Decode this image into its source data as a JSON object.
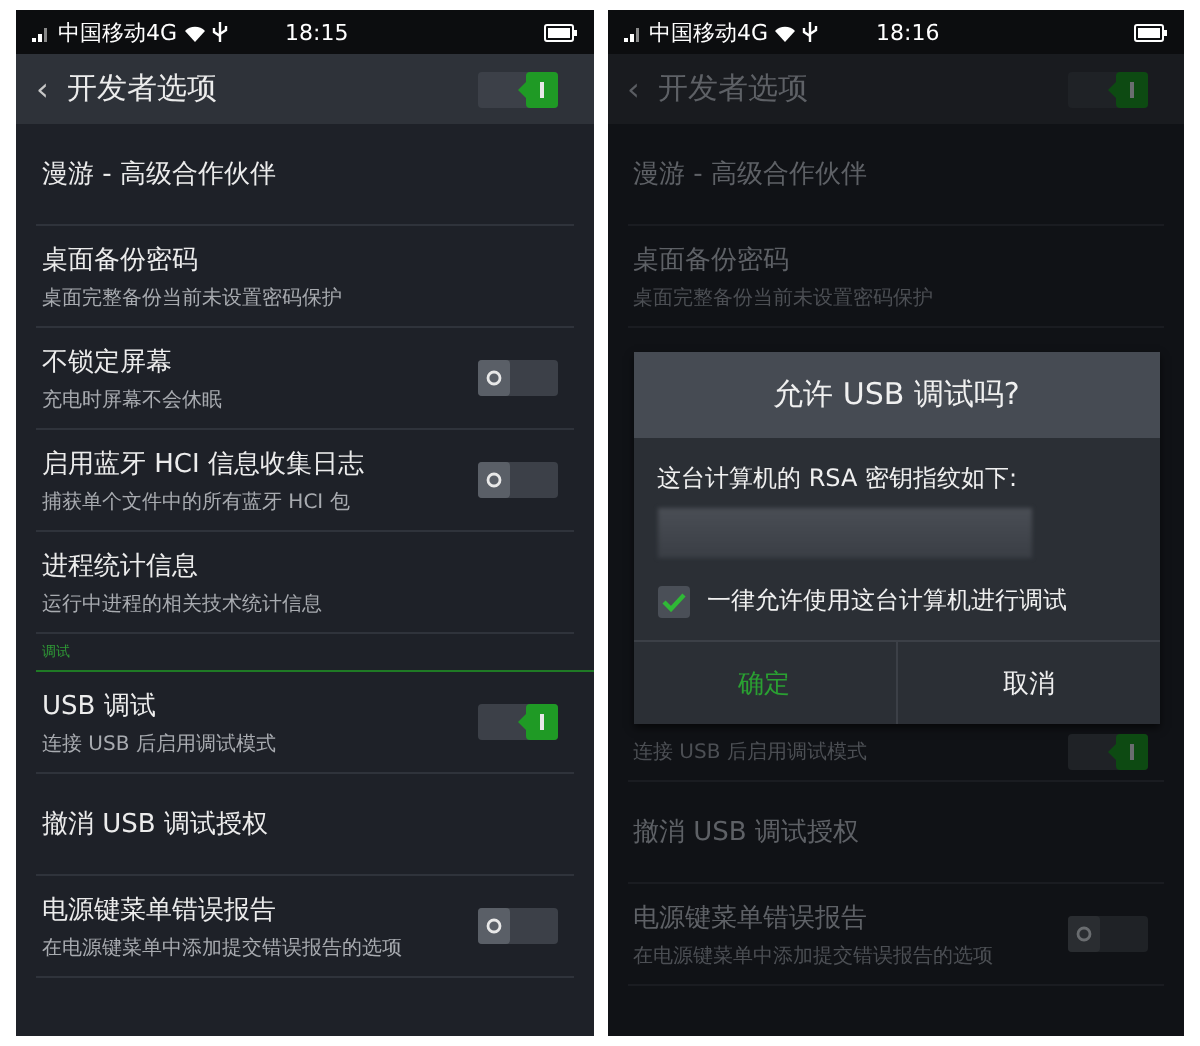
{
  "screens": [
    {
      "dimmed": false,
      "status_bar": {
        "carrier": "中国移动4G",
        "time": "18:15"
      },
      "header": {
        "back": "‹",
        "title": "开发者选项",
        "on": true
      },
      "items": [
        {
          "kind": "row",
          "title": "漫游 - 高级合作伙伴"
        },
        {
          "kind": "row",
          "title": "桌面备份密码",
          "subtitle": "桌面完整备份当前未设置密码保护"
        },
        {
          "kind": "row",
          "title": "不锁定屏幕",
          "subtitle": "充电时屏幕不会休眠",
          "on": false
        },
        {
          "kind": "row",
          "title": "启用蓝牙 HCI 信息收集日志",
          "subtitle": "捕获单个文件中的所有蓝牙 HCI 包",
          "on": false
        },
        {
          "kind": "row",
          "title": "进程统计信息",
          "subtitle": "运行中进程的相关技术统计信息"
        },
        {
          "kind": "section",
          "label": "调试"
        },
        {
          "kind": "row",
          "title": "USB 调试",
          "subtitle": "连接 USB 后启用调试模式",
          "on": true
        },
        {
          "kind": "row",
          "title": "撤消 USB 调试授权"
        },
        {
          "kind": "row",
          "title": "电源键菜单错误报告",
          "subtitle": "在电源键菜单中添加提交错误报告的选项",
          "on": false
        }
      ]
    },
    {
      "dimmed": true,
      "status_bar": {
        "carrier": "中国移动4G",
        "time": "18:16"
      },
      "header": {
        "back": "‹",
        "title": "开发者选项",
        "on": true
      },
      "items": [
        {
          "kind": "row",
          "title": "漫游 - 高级合作伙伴"
        },
        {
          "kind": "row",
          "title": "桌面备份密码",
          "subtitle": "桌面完整备份当前未设置密码保护"
        },
        {
          "kind": "dialog",
          "title": "允许 USB 调试吗?",
          "message": "这台计算机的 RSA 密钥指纹如下:",
          "checkbox": {
            "label": "一律允许使用这台计算机进行调试",
            "checked": true
          },
          "buttons": [
            "确定",
            "取消"
          ]
        },
        {
          "kind": "row",
          "subtitle": "连接 USB 后启用调试模式",
          "on": true
        },
        {
          "kind": "row",
          "title": "撤消 USB 调试授权"
        },
        {
          "kind": "row",
          "title": "电源键菜单错误报告",
          "subtitle": "在电源键菜单中添加提交错误报告的选项",
          "on": false
        }
      ]
    }
  ]
}
